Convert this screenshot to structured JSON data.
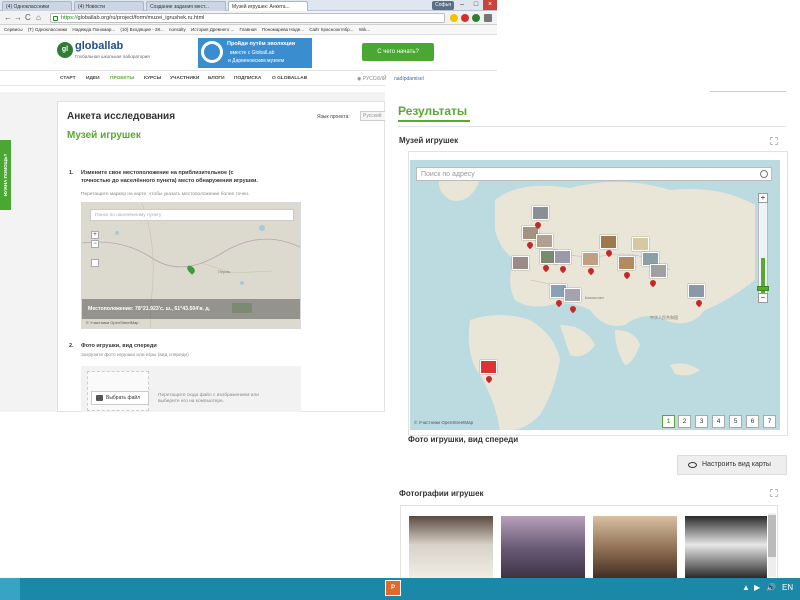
{
  "browser": {
    "tabs": [
      {
        "label": "(4) Одноклассники",
        "active": false
      },
      {
        "label": "(4) Новости",
        "active": false
      },
      {
        "label": "Создание задания мест...",
        "active": false
      },
      {
        "label": "Музей игрушек: Анкета...",
        "active": true
      }
    ],
    "user_button": "Софья",
    "window_controls": {
      "minimize": "–",
      "maximize": "□",
      "close": "×"
    },
    "url_https": "https://",
    "url_rest": "globallab.org/ru/project/form/muzei_igrushek.ru.html",
    "nav": {
      "back": "←",
      "forward": "→",
      "reload": "C",
      "home": "⌂"
    },
    "bookmarks": [
      "Сервисы",
      "(T) Одноклассники",
      "Надежда Пономар...",
      "(10) Входящие - 28...",
      "nonsalty",
      "История Древнего ...",
      "Главная",
      "Пономарева Наде...",
      "Сайт Краснооктябр...",
      "Wik..."
    ]
  },
  "site": {
    "logo_mark": "gl",
    "logo": "globallab",
    "logo_sub": "Глобальная школьная лаборатория",
    "banner": {
      "line1": "Пройди путём эволюции",
      "line2": "вместе с GlobalLab",
      "line3": "и Дарвиновским музеем"
    },
    "cta": "С чего начать?",
    "nav": [
      "СТАРТ",
      "ИДЕИ",
      "ПРОЕКТЫ",
      "КУРСЫ",
      "УЧАСТНИКИ",
      "БЛОГИ",
      "ПОДПИСКА",
      "О GLOBALLAB"
    ],
    "language": "РУССКИЙ",
    "login": "nadIpdamisel"
  },
  "form": {
    "help_tab": "НУЖНА ПОМОЩЬ?",
    "title": "Анкета исследования",
    "subtitle": "Музей игрушек",
    "project_lang_label": "Язык проекта:",
    "project_lang_value": "Русский",
    "q1": {
      "number": "1.",
      "text_line1": "Измените свое местоположение на приблизительное (с",
      "text_line2": "точностью до населённого пункта) место обнаружения игрушки.",
      "hint": "Перетащите маркер на карте, чтобы указать местоположение более точно.",
      "search_placeholder": "Поиск по населённому пункту",
      "zoom_in": "+",
      "zoom_out": "−",
      "location": "Местоположение: 78°21.923'с. ш., 61°43.504'в. д.",
      "attribution": "© Участники OpenStreetMap",
      "place_label": "Пермь"
    },
    "q2": {
      "number": "2.",
      "text": "Фото игрушки, вид спереди",
      "hint": "Загрузите фото игрушки или игры (вид спереди)",
      "choose_file": "Выбрать файл",
      "drop_hint": "Перетащите сюда файл с изображением или выберите его на компьютере."
    }
  },
  "results": {
    "title": "Результаты",
    "map_section": "Музей игрушек",
    "map_search_placeholder": "Поиск по адресу",
    "zoom_in": "+",
    "zoom_out": "−",
    "attribution": "© Участники OpenStreetMap",
    "pages": [
      "1",
      "2",
      "3",
      "4",
      "5",
      "6",
      "7"
    ],
    "active_page": "1",
    "map_caption": "Фото игрушки, вид спереди",
    "configure_button": "Настроить вид карты",
    "photos_title": "Фотографии игрушек",
    "cities": [
      "Казахстан",
      "中华人民共和国"
    ]
  },
  "taskbar": {
    "start_label": "P",
    "tray": [
      "▲",
      "▶",
      "🔊",
      "EN"
    ]
  },
  "colors": {
    "accent_green": "#5aa832",
    "cta_green": "#4aa832",
    "marker_red": "#c62828",
    "taskbar": "#1c88a8",
    "link_blue": "#3a6fb0"
  }
}
